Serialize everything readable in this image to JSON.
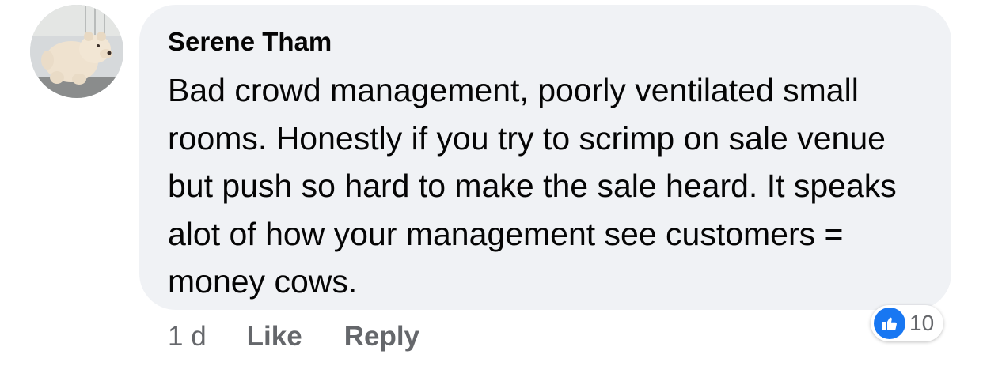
{
  "comment": {
    "author": "Serene Tham",
    "text": "Bad crowd management, poorly ventilated small rooms. Honestly if you try to scrimp on sale venue but push so hard to make the sale heard. It speaks alot of how your management see customers = money cows.",
    "avatar_icon": "polar-bear-plush-avatar"
  },
  "actions": {
    "timestamp": "1 d",
    "like_label": "Like",
    "reply_label": "Reply"
  },
  "reactions": {
    "icon": "thumbs-up-icon",
    "count": "10",
    "color": "#1877f2"
  },
  "colors": {
    "bubble": "#f0f2f5",
    "text": "#050505",
    "secondary": "#65676b"
  }
}
